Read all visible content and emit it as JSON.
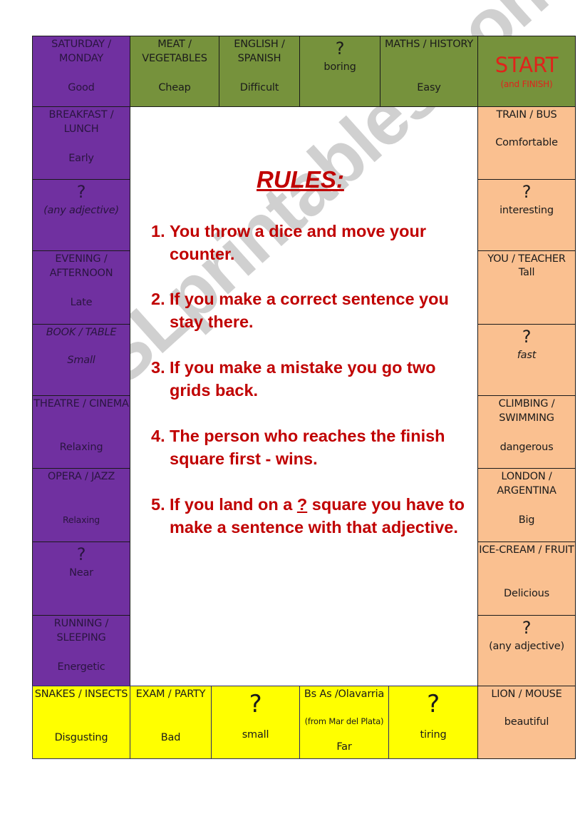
{
  "colors": {
    "purple": "#7030a0",
    "green": "#76923c",
    "orange": "#fac090",
    "yellow": "#ffff00",
    "rules_red": "#c00000",
    "start_red": "#e0231b"
  },
  "watermark": "ESLprintables.com",
  "question_mark": "?",
  "top_row": [
    {
      "heading": "SATURDAY / MONDAY",
      "word": "Good"
    },
    {
      "heading": "MEAT / VEGETABLES",
      "word": "Cheap"
    },
    {
      "heading": "ENGLISH / SPANISH",
      "word": "Difficult"
    },
    {
      "word": "boring"
    },
    {
      "heading": "MATHS / HISTORY",
      "word": "Easy"
    },
    {
      "start": "START",
      "sub": "(and FINISH)"
    }
  ],
  "left_column": [
    {
      "heading": "BREAKFAST / LUNCH",
      "word": "Early"
    },
    {
      "word": "(any adjective)"
    },
    {
      "heading": "EVENING / AFTERNOON",
      "word": "Late"
    },
    {
      "heading": "BOOK / TABLE",
      "word": "Small"
    },
    {
      "heading": "THEATRE / CINEMA",
      "word": "Relaxing"
    },
    {
      "heading": "OPERA / JAZZ",
      "word": "Relaxing"
    },
    {
      "word": "Near"
    },
    {
      "heading": "RUNNING / SLEEPING",
      "word": "Energetic"
    }
  ],
  "right_column": [
    {
      "heading": "TRAIN / BUS",
      "word": "Comfortable"
    },
    {
      "word": "interesting"
    },
    {
      "heading": "YOU / TEACHER",
      "word": "Tall"
    },
    {
      "word": "fast"
    },
    {
      "heading": "CLIMBING / SWIMMING",
      "word": "dangerous"
    },
    {
      "heading": "LONDON / ARGENTINA",
      "word": "Big"
    },
    {
      "heading": "ICE-CREAM / FRUIT",
      "word": "Delicious"
    },
    {
      "word": "(any adjective)"
    }
  ],
  "bottom_row": [
    {
      "heading": "SNAKES / INSECTS",
      "word": "Disgusting"
    },
    {
      "heading": "EXAM / PARTY",
      "word": "Bad"
    },
    {
      "word": "small"
    },
    {
      "heading": "Bs As /Olavarria",
      "note": "(from Mar del Plata)",
      "word": "Far"
    },
    {
      "word": "tiring"
    },
    {
      "heading": "LION / MOUSE",
      "word": "beautiful"
    }
  ],
  "rules": {
    "title": "RULES:",
    "items": [
      {
        "num": "1.",
        "text": "You throw a dice and move your counter."
      },
      {
        "num": "2.",
        "text": "If you make a correct sentence you stay there."
      },
      {
        "num": "3.",
        "text": "If you make a mistake you go two grids back."
      },
      {
        "num": "4.",
        "text": "The person who reaches the finish square first - wins."
      },
      {
        "num": "5.",
        "pre": "If you land on a ",
        "mark": "?",
        "post": " square you have to make a sentence with that adjective."
      }
    ]
  }
}
